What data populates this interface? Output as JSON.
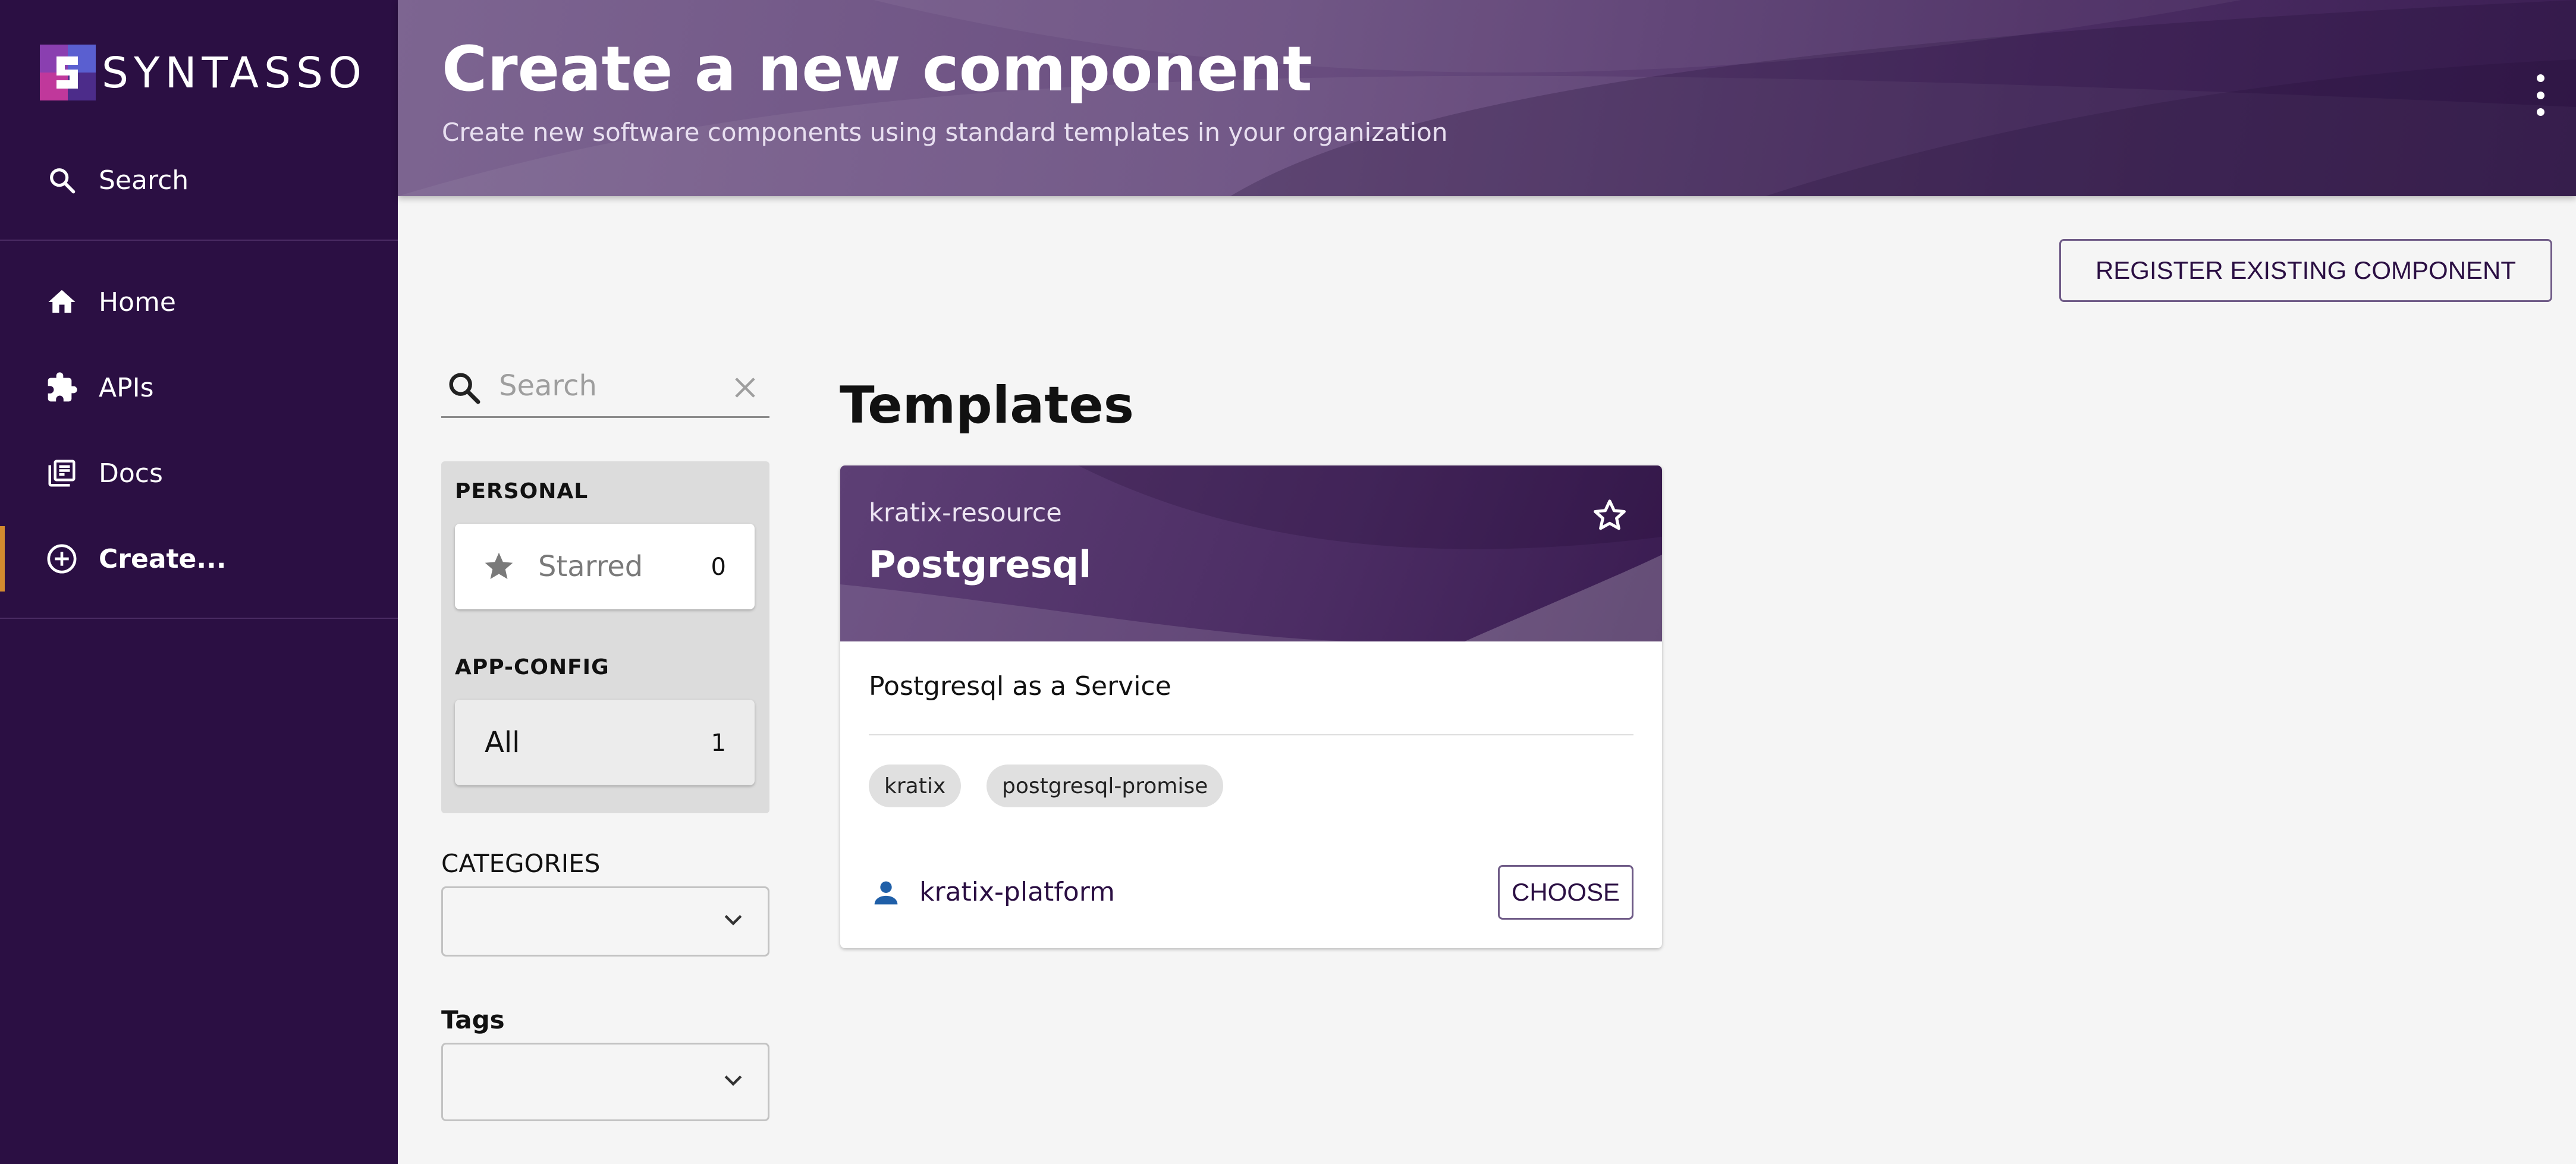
{
  "brand": {
    "name": "SYNTASSO"
  },
  "sidebar": {
    "search_label": "Search",
    "items": [
      {
        "label": "Home",
        "icon": "home-icon"
      },
      {
        "label": "APIs",
        "icon": "puzzle-icon"
      },
      {
        "label": "Docs",
        "icon": "library-books-icon"
      },
      {
        "label": "Create...",
        "icon": "add-circle-icon",
        "active": true
      }
    ]
  },
  "header": {
    "title": "Create a new component",
    "subtitle": "Create new software components using standard templates in your organization"
  },
  "register_button": "REGISTER EXISTING COMPONENT",
  "search": {
    "placeholder": "Search",
    "value": ""
  },
  "filters": {
    "personal_heading": "PERSONAL",
    "starred": {
      "label": "Starred",
      "count": "0"
    },
    "appconfig_heading": "APP-CONFIG",
    "all": {
      "label": "All",
      "count": "1"
    }
  },
  "categories": {
    "label": "CATEGORIES",
    "value": ""
  },
  "tags": {
    "label": "Tags",
    "value": ""
  },
  "templates": {
    "title": "Templates",
    "cards": [
      {
        "kind": "kratix-resource",
        "name": "Postgresql",
        "description": "Postgresql as a Service",
        "tags": [
          "kratix",
          "postgresql-promise"
        ],
        "owner": "kratix-platform",
        "action": "CHOOSE"
      }
    ]
  },
  "colors": {
    "sidebar_bg": "#2b0f43",
    "active_indicator": "#d38b2f",
    "accent": "#2b0f43",
    "owner_icon": "#1f5fa8"
  }
}
